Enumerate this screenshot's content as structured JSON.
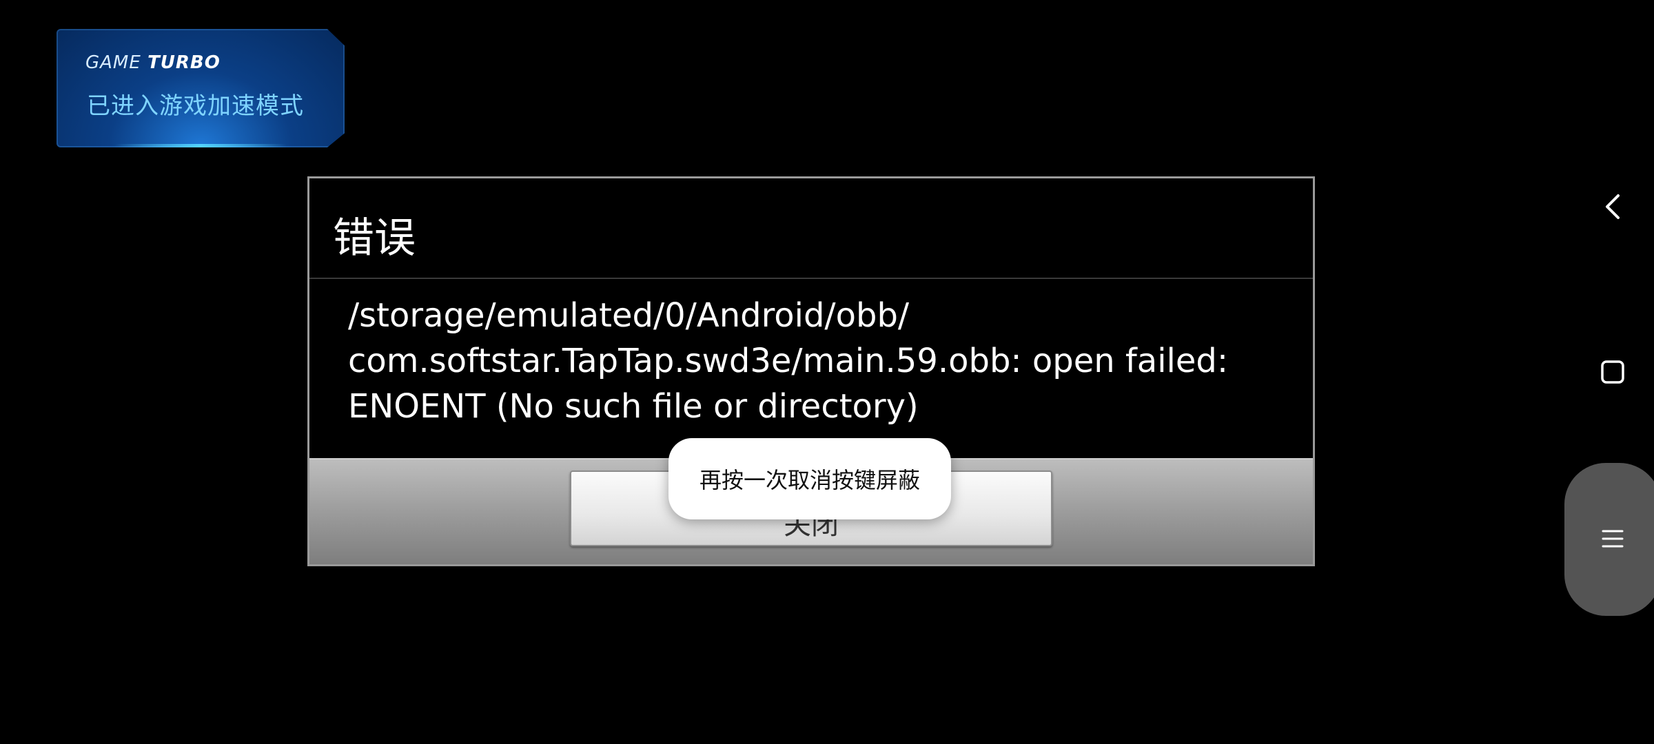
{
  "turbo_badge": {
    "brand_light": "GAME",
    "brand_bold": "TURBO",
    "message": "已进入游戏加速模式"
  },
  "background_dialog": {
    "title": "错误"
  },
  "dialog": {
    "title": "错误",
    "message": "/storage/emulated/0/Android/obb/\ncom.softstar.TapTap.swd3e/main.59.obb: open failed:\nENOENT (No such file or directory)",
    "close_label": "关闭"
  },
  "toast": {
    "text": "再按一次取消按键屏蔽"
  },
  "nav": {
    "back_icon": "chevron-left-icon",
    "home_icon": "square-icon",
    "menu_icon": "menu-icon"
  },
  "colors": {
    "turbo_text": "#7fd4ff",
    "dialog_border": "#9a9a9a",
    "footer": "#9c9c9c"
  }
}
